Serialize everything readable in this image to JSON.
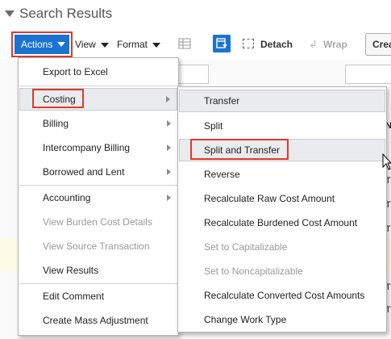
{
  "header": {
    "title": "Search Results"
  },
  "toolbar": {
    "actions_label": "Actions",
    "view_label": "View",
    "format_label": "Format",
    "detach_label": "Detach",
    "wrap_label": "Wrap",
    "create_label": "Crea"
  },
  "actions_menu": {
    "items": [
      {
        "label": "Export to Excel",
        "submenu": false,
        "disabled": false
      },
      {
        "label": "Costing",
        "submenu": true,
        "disabled": false,
        "highlighted": true
      },
      {
        "label": "Billing",
        "submenu": true,
        "disabled": false
      },
      {
        "label": "Intercompany Billing",
        "submenu": true,
        "disabled": false
      },
      {
        "label": "Borrowed and Lent",
        "submenu": true,
        "disabled": false
      },
      {
        "label": "Accounting",
        "submenu": true,
        "disabled": false
      },
      {
        "label": "View Burden Cost Details",
        "submenu": false,
        "disabled": true
      },
      {
        "label": "View Source Transaction",
        "submenu": false,
        "disabled": true
      },
      {
        "label": "View Results",
        "submenu": false,
        "disabled": false
      },
      {
        "label": "Edit Comment",
        "submenu": false,
        "disabled": false
      },
      {
        "label": "Create Mass Adjustment",
        "submenu": false,
        "disabled": false
      }
    ]
  },
  "costing_menu": {
    "items": [
      {
        "label": "Transfer",
        "disabled": false
      },
      {
        "label": "Split",
        "disabled": false
      },
      {
        "label": "Split and Transfer",
        "disabled": false,
        "highlighted": true
      },
      {
        "label": "Reverse",
        "disabled": false
      },
      {
        "label": "Recalculate Raw Cost Amount",
        "disabled": false
      },
      {
        "label": "Recalculate Burdened Cost Amount",
        "disabled": false
      },
      {
        "label": "Set to Capitalizable",
        "disabled": true
      },
      {
        "label": "Set to Noncapitalizable",
        "disabled": true
      },
      {
        "label": "Recalculate Converted Cost Amounts",
        "disabled": false
      },
      {
        "label": "Change Work Type",
        "disabled": false
      }
    ]
  },
  "background": {
    "col_header_fragment": "N",
    "cell_fragment": "T"
  },
  "colors": {
    "accent": "#1b73d1",
    "highlight_border": "#e0392d",
    "disabled_text": "#9a9a9a"
  },
  "icons": [
    "collapse-triangle-icon",
    "caret-down-icon",
    "freeze-columns-icon",
    "query-by-example-icon",
    "detach-icon",
    "wrap-icon",
    "submenu-arrow-icon",
    "mouse-cursor-icon"
  ]
}
